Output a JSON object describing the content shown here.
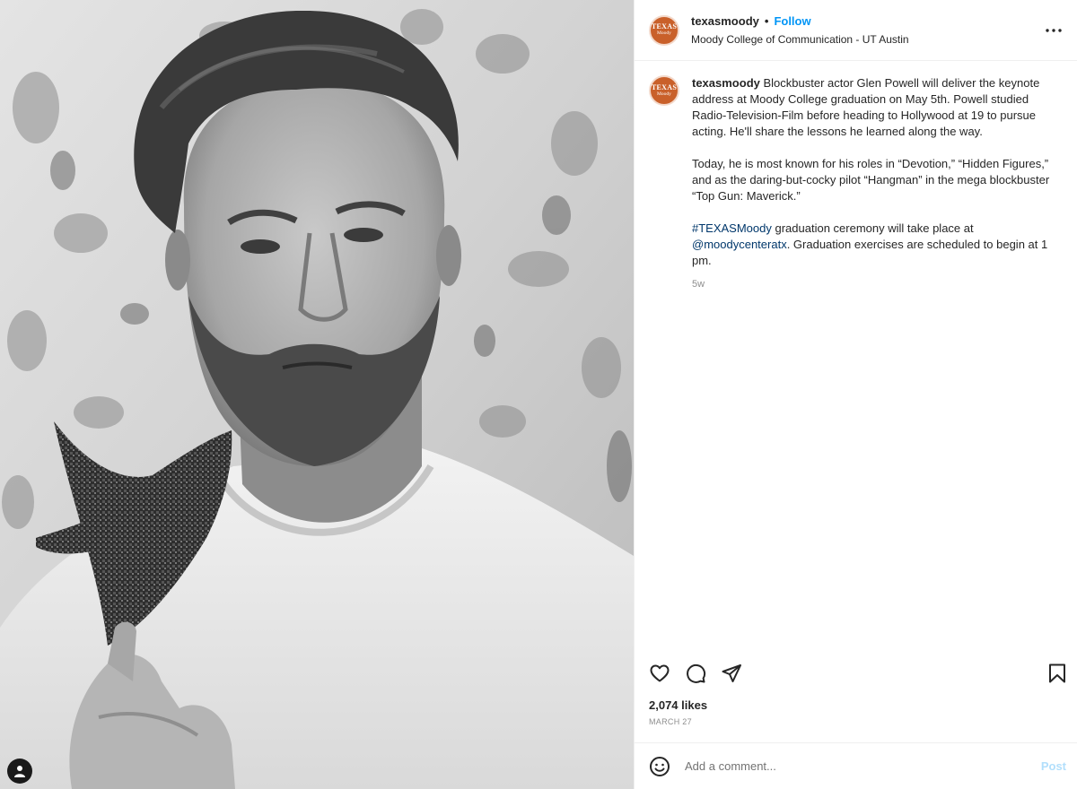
{
  "account": {
    "username": "texasmoody",
    "separator": "•",
    "follow_label": "Follow",
    "location": "Moody College of Communication - UT Austin",
    "logo_line1": "TEXAS",
    "logo_line2": "Moody"
  },
  "caption": {
    "username": "texasmoody",
    "paragraph1": "Blockbuster actor Glen Powell will deliver the keynote address at Moody College graduation on May 5th. Powell studied Radio-Television-Film before heading to Hollywood at 19 to pursue acting. He'll share the lessons he learned along the way.",
    "paragraph2": "Today, he is most known for his roles in “Devotion,” “Hidden Figures,” and as the daring-but-cocky pilot “Hangman” in the mega blockbuster “Top Gun: Maverick.”",
    "hashtag": "#TEXASMoody",
    "paragraph3_mid": " graduation ceremony will take place at ",
    "mention": "@moodycenteratx",
    "paragraph3_end": ". Graduation exercises are scheduled to begin at 1 pm.",
    "age": "5w"
  },
  "stats": {
    "likes": "2,074 likes",
    "date": "MARCH 27"
  },
  "comment": {
    "placeholder": "Add a comment...",
    "post_label": "Post"
  },
  "icons": {
    "more": "more-horizontal-icon",
    "like": "heart-icon",
    "comment": "comment-icon",
    "share": "paper-plane-icon",
    "save": "bookmark-icon",
    "emoji": "emoji-icon",
    "viewer": "user-avatar-icon"
  },
  "colors": {
    "follow": "#0095f6",
    "link": "#00376b",
    "logo": "#c9602a",
    "post_disabled": "#b2dffc"
  }
}
